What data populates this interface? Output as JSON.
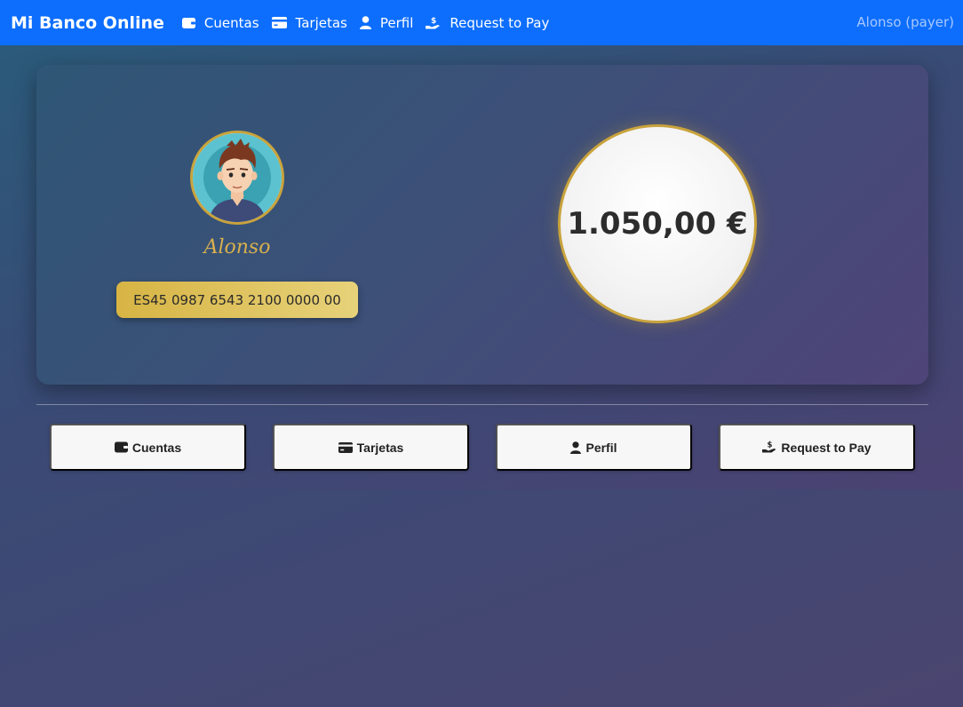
{
  "navbar": {
    "brand": "Mi Banco Online",
    "links": [
      {
        "label": "Cuentas",
        "icon": "wallet-icon"
      },
      {
        "label": "Tarjetas",
        "icon": "credit-card-icon"
      },
      {
        "label": "Perfil",
        "icon": "user-icon"
      },
      {
        "label": "Request to Pay",
        "icon": "hand-money-icon"
      }
    ],
    "user": "Alonso (payer)"
  },
  "profile": {
    "name": "Alonso",
    "iban": "ES45 0987 6543 2100 0000 00"
  },
  "balance": {
    "amount": "1.050,00 €"
  },
  "actions": [
    {
      "label": "Cuentas",
      "icon": "wallet-icon"
    },
    {
      "label": "Tarjetas",
      "icon": "credit-card-icon"
    },
    {
      "label": "Perfil",
      "icon": "user-icon"
    },
    {
      "label": "Request to Pay",
      "icon": "hand-money-icon"
    }
  ],
  "colors": {
    "navbar": "#0d6efd",
    "gold": "#c9a33c"
  }
}
